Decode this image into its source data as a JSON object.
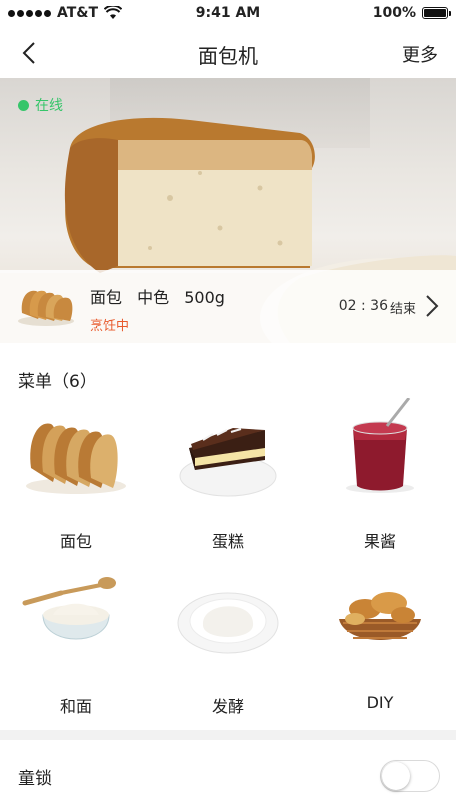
{
  "status_bar": {
    "carrier": "AT&T",
    "time": "9:41 AM",
    "battery": "100%"
  },
  "nav": {
    "title": "面包机",
    "more": "更多"
  },
  "hero": {
    "online_label": "在线"
  },
  "cooking": {
    "item": "面包",
    "color": "中色",
    "weight": "500g",
    "state": "烹饪中",
    "remaining": "02 : 36",
    "end_label": "结束"
  },
  "menu": {
    "header": "菜单（6）",
    "items": [
      {
        "label": "面包"
      },
      {
        "label": "蛋糕"
      },
      {
        "label": "果酱"
      },
      {
        "label": "和面"
      },
      {
        "label": "发酵"
      },
      {
        "label": "DIY"
      }
    ]
  },
  "child_lock": {
    "label": "童锁",
    "enabled": false
  },
  "colors": {
    "online": "#36c56a",
    "cooking_state": "#e8592b"
  }
}
